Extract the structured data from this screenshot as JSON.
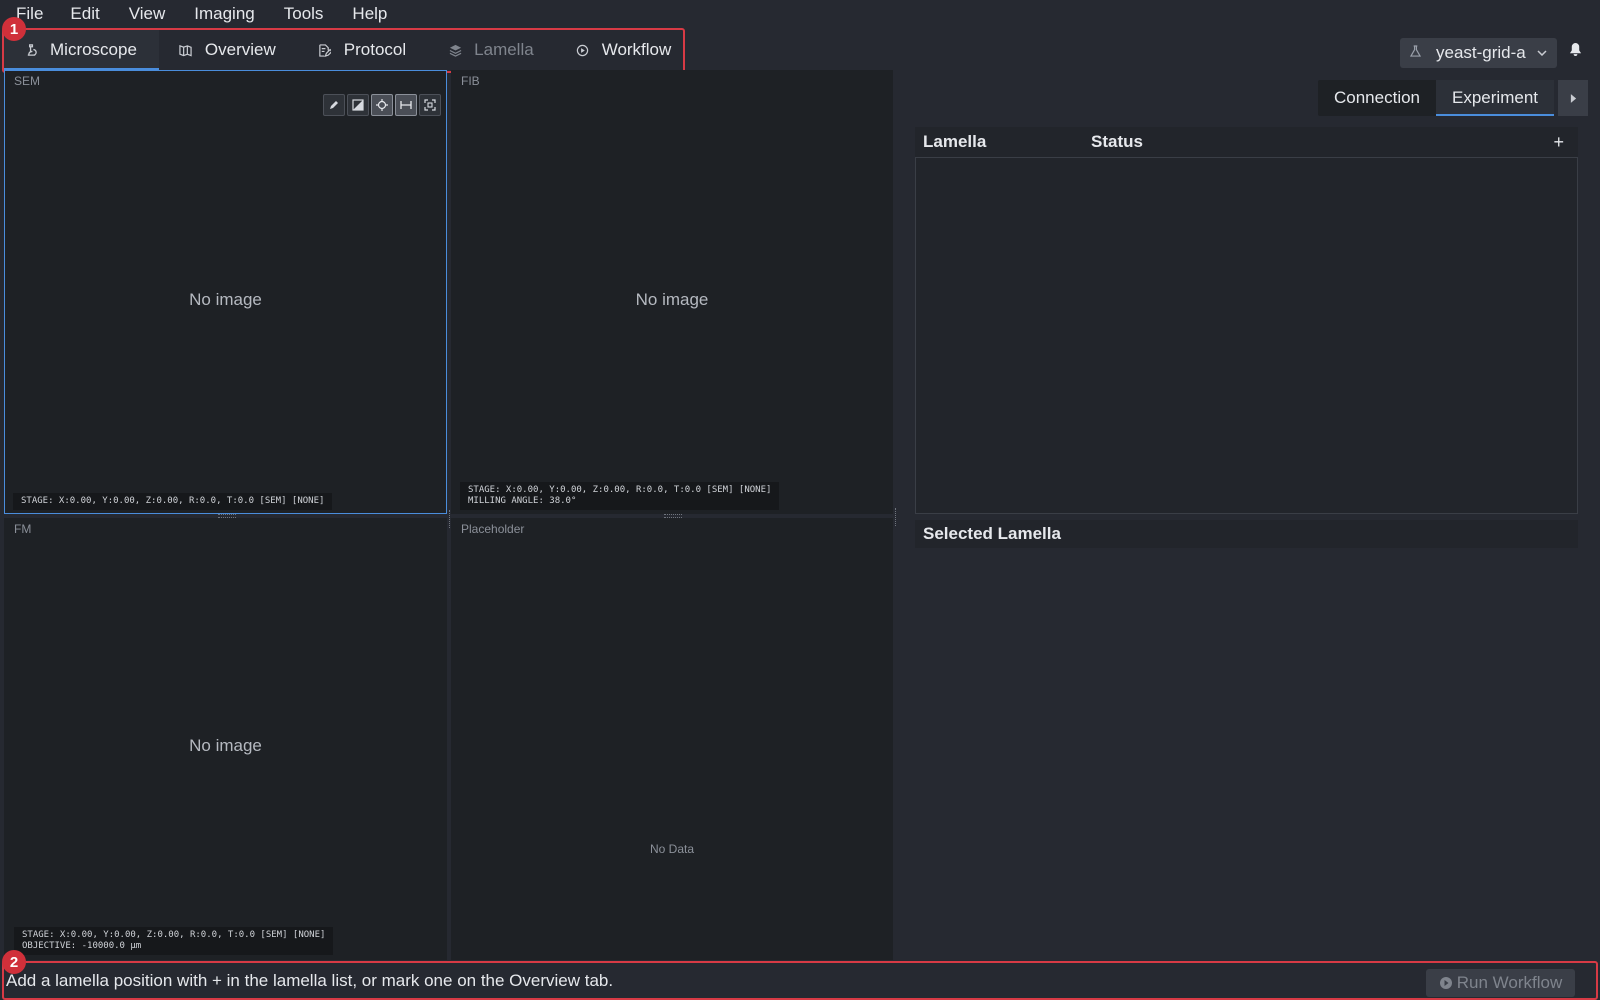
{
  "menu": [
    "File",
    "Edit",
    "View",
    "Imaging",
    "Tools",
    "Help"
  ],
  "tabs": [
    {
      "label": "Microscope",
      "icon": "microscope-icon"
    },
    {
      "label": "Overview",
      "icon": "map-icon"
    },
    {
      "label": "Protocol",
      "icon": "document-edit-icon"
    },
    {
      "label": "Lamella",
      "icon": "layers-icon"
    },
    {
      "label": "Workflow",
      "icon": "play-circle-icon"
    }
  ],
  "markers": [
    "1",
    "2"
  ],
  "experiment": {
    "name": "yeast-grid-a"
  },
  "panels": {
    "sem": {
      "label": "SEM",
      "message": "No image",
      "stage_line1": "STAGE: X:0.00, Y:0.00, Z:0.00, R:0.0, T:0.0 [SEM] [NONE]"
    },
    "fib": {
      "label": "FIB",
      "message": "No image",
      "stage_line1": "STAGE: X:0.00, Y:0.00, Z:0.00, R:0.0, T:0.0 [SEM] [NONE]",
      "stage_line2": "MILLING ANGLE: 38.0°"
    },
    "fm": {
      "label": "FM",
      "message": "No image",
      "stage_line1": "STAGE: X:0.00, Y:0.00, Z:0.00, R:0.0, T:0.0 [SEM] [NONE]",
      "stage_line2": "OBJECTIVE: -10000.0 µm"
    },
    "placeholder": {
      "label": "Placeholder",
      "message": "No Data"
    }
  },
  "sidebar": {
    "tabs": [
      "Connection",
      "Experiment"
    ],
    "lamella_header": {
      "col1": "Lamella",
      "col2": "Status",
      "add": "+"
    },
    "selected_header": "Selected Lamella"
  },
  "status": {
    "message": "Add a lamella position with + in the lamella list, or mark one on the Overview tab.",
    "run_label": "Run Workflow"
  }
}
